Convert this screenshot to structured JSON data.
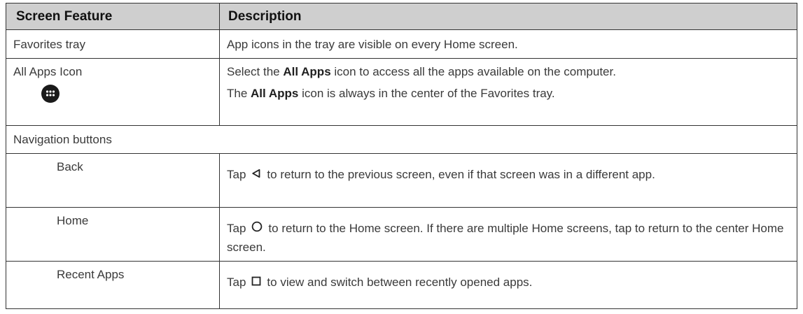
{
  "header": {
    "col1": "Screen Feature",
    "col2": "Description"
  },
  "rows": {
    "favorites": {
      "feature": "Favorites tray",
      "description": "App icons in the tray are visible on every Home screen."
    },
    "all_apps": {
      "feature": "All Apps Icon",
      "icon": "all-apps-icon",
      "line1_pre": "Select the ",
      "line1_bold": "All Apps",
      "line1_post": " icon to access all the apps available on the computer.",
      "line2_pre": "The ",
      "line2_bold": "All Apps",
      "line2_post": " icon is always in the center of the Favorites tray."
    },
    "navigation": {
      "label": "Navigation buttons"
    },
    "back": {
      "feature": "Back",
      "icon": "back-triangle-icon",
      "pre": "Tap",
      "post": "to return to the previous screen, even if that screen was in a different app."
    },
    "home": {
      "feature": "Home",
      "icon": "home-circle-icon",
      "pre": "Tap",
      "post": "to return to the Home screen. If there are multiple Home screens, tap to return to the center Home screen."
    },
    "recent": {
      "feature": "Recent Apps",
      "icon": "recent-square-icon",
      "pre": "Tap",
      "post": "to view and switch between recently opened apps."
    }
  }
}
